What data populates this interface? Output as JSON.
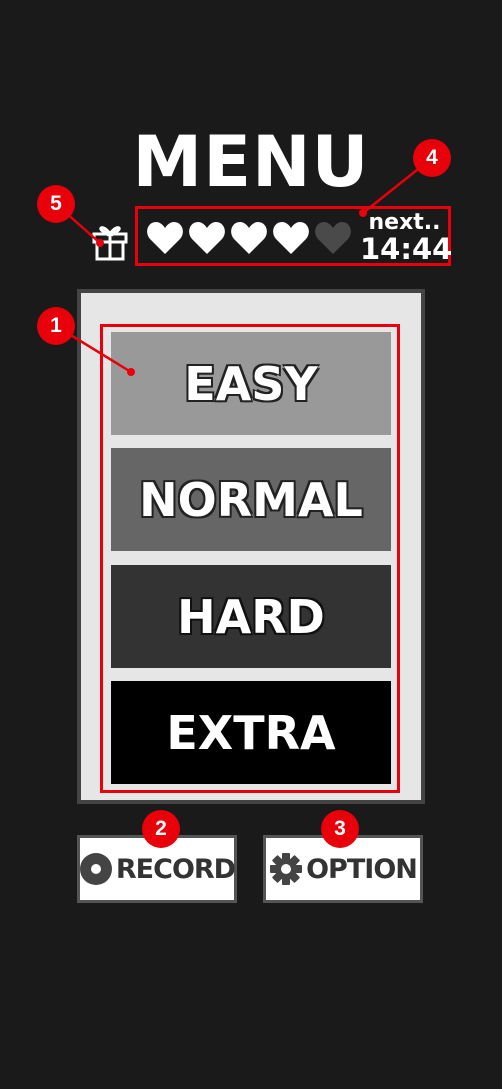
{
  "header": {
    "title": "MENU"
  },
  "status": {
    "gift_icon": "gift-icon",
    "hearts": {
      "filled": 4,
      "total": 5,
      "filled_color": "#ffffff",
      "empty_color": "#4a4a4a"
    },
    "next_label": "next..",
    "next_time": "14:44"
  },
  "difficulty": {
    "items": [
      {
        "label": "EASY",
        "color": "#999999"
      },
      {
        "label": "NORMAL",
        "color": "#666666"
      },
      {
        "label": "HARD",
        "color": "#333333"
      },
      {
        "label": "EXTRA",
        "color": "#000000"
      }
    ]
  },
  "buttons": {
    "record_label": "RECORD",
    "record_icon": "disc-icon",
    "option_label": "OPTION",
    "option_icon": "gear-icon"
  },
  "annotations": {
    "color": "#e8000b",
    "badges": [
      "1",
      "2",
      "3",
      "4",
      "5"
    ]
  }
}
